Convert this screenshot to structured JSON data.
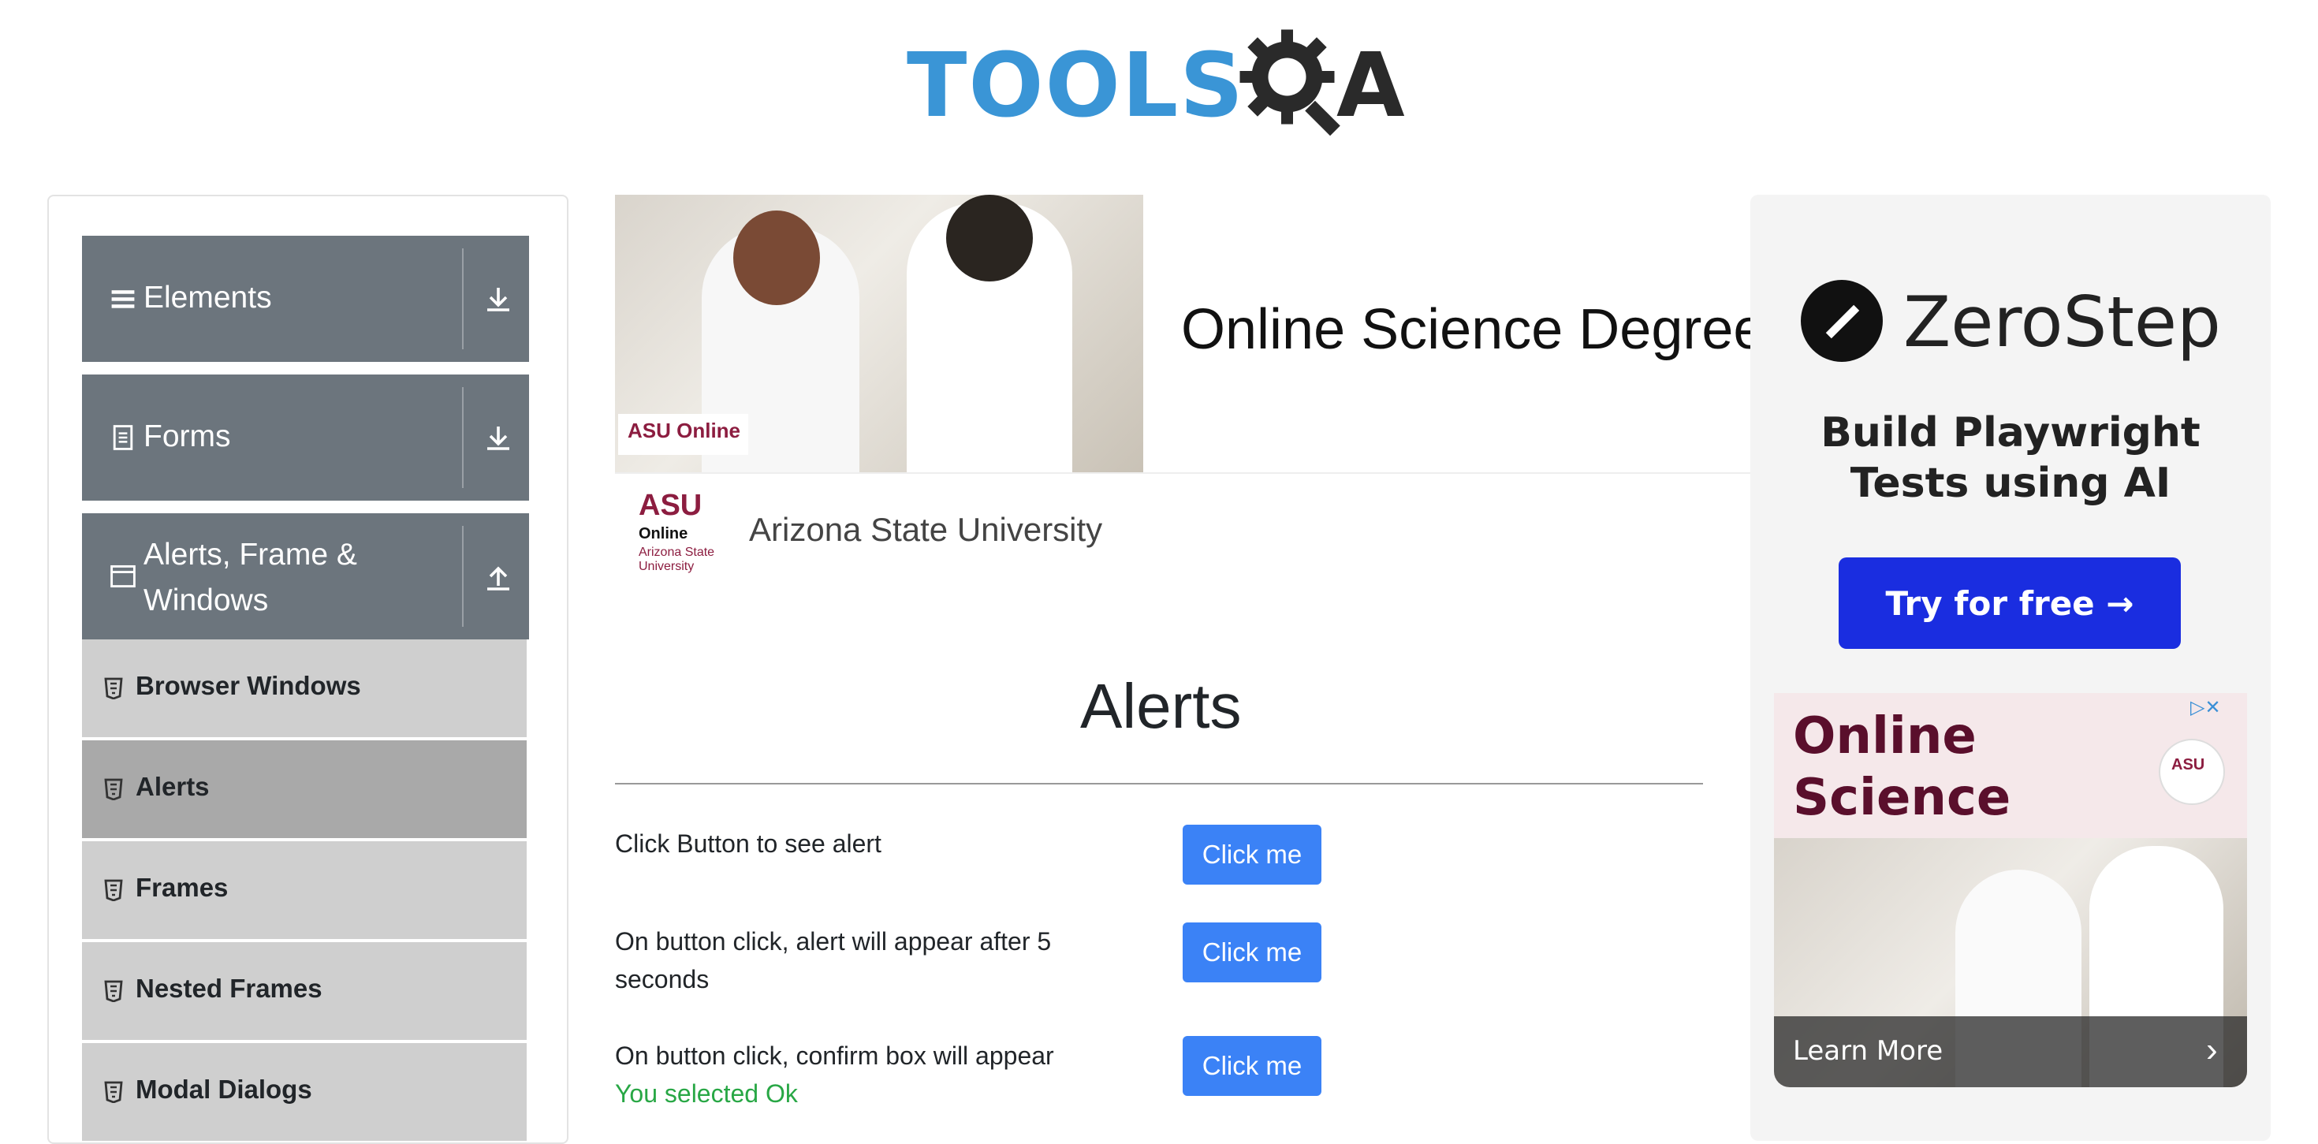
{
  "logo": {
    "text": "TOOLS",
    "suffix": "A"
  },
  "sidebar": {
    "groups": [
      {
        "label": "Elements",
        "icon": "menu-icon",
        "arrow": "download-arrow-icon"
      },
      {
        "label": "Forms",
        "icon": "document-icon",
        "arrow": "download-arrow-icon"
      },
      {
        "label": "Alerts, Frame & Windows",
        "icon": "window-icon",
        "arrow": "upload-arrow-icon"
      }
    ],
    "items": [
      {
        "label": "Browser Windows",
        "active": false
      },
      {
        "label": "Alerts",
        "active": true
      },
      {
        "label": "Frames",
        "active": false
      },
      {
        "label": "Nested Frames",
        "active": false
      },
      {
        "label": "Modal Dialogs",
        "active": false
      }
    ]
  },
  "ad_top": {
    "badge": "ASU Online",
    "title": "Online Science Degree",
    "uni_logo_top": "ASU",
    "uni_logo_mid": "Online",
    "uni_logo_bottom": "Arizona State University",
    "uni_name": "Arizona State University"
  },
  "main": {
    "title": "Alerts",
    "rows": [
      {
        "label": "Click Button to see alert",
        "button": "Click me",
        "result": ""
      },
      {
        "label": "On button click, alert will appear after 5 seconds",
        "button": "Click me",
        "result": ""
      },
      {
        "label": "On button click, confirm box will appear",
        "button": "Click me",
        "result": "You selected Ok"
      }
    ]
  },
  "ad_right": {
    "brand": "ZeroStep",
    "tagline": "Build Playwright Tests using AI",
    "cta": "Try for free →",
    "asu_headline": "Online Science Degrees",
    "asu_badge": "ASU",
    "learn_more": "Learn More",
    "ad_choices": "▷✕"
  },
  "colors": {
    "sidebar_header": "#6c757d",
    "sidebar_item": "#cfcfcf",
    "sidebar_active": "#a9a9a9",
    "primary_button": "#3b82f6",
    "success_text": "#28a745",
    "zerostep_cta": "#1a2de0",
    "asu_maroon": "#8c1d40"
  }
}
